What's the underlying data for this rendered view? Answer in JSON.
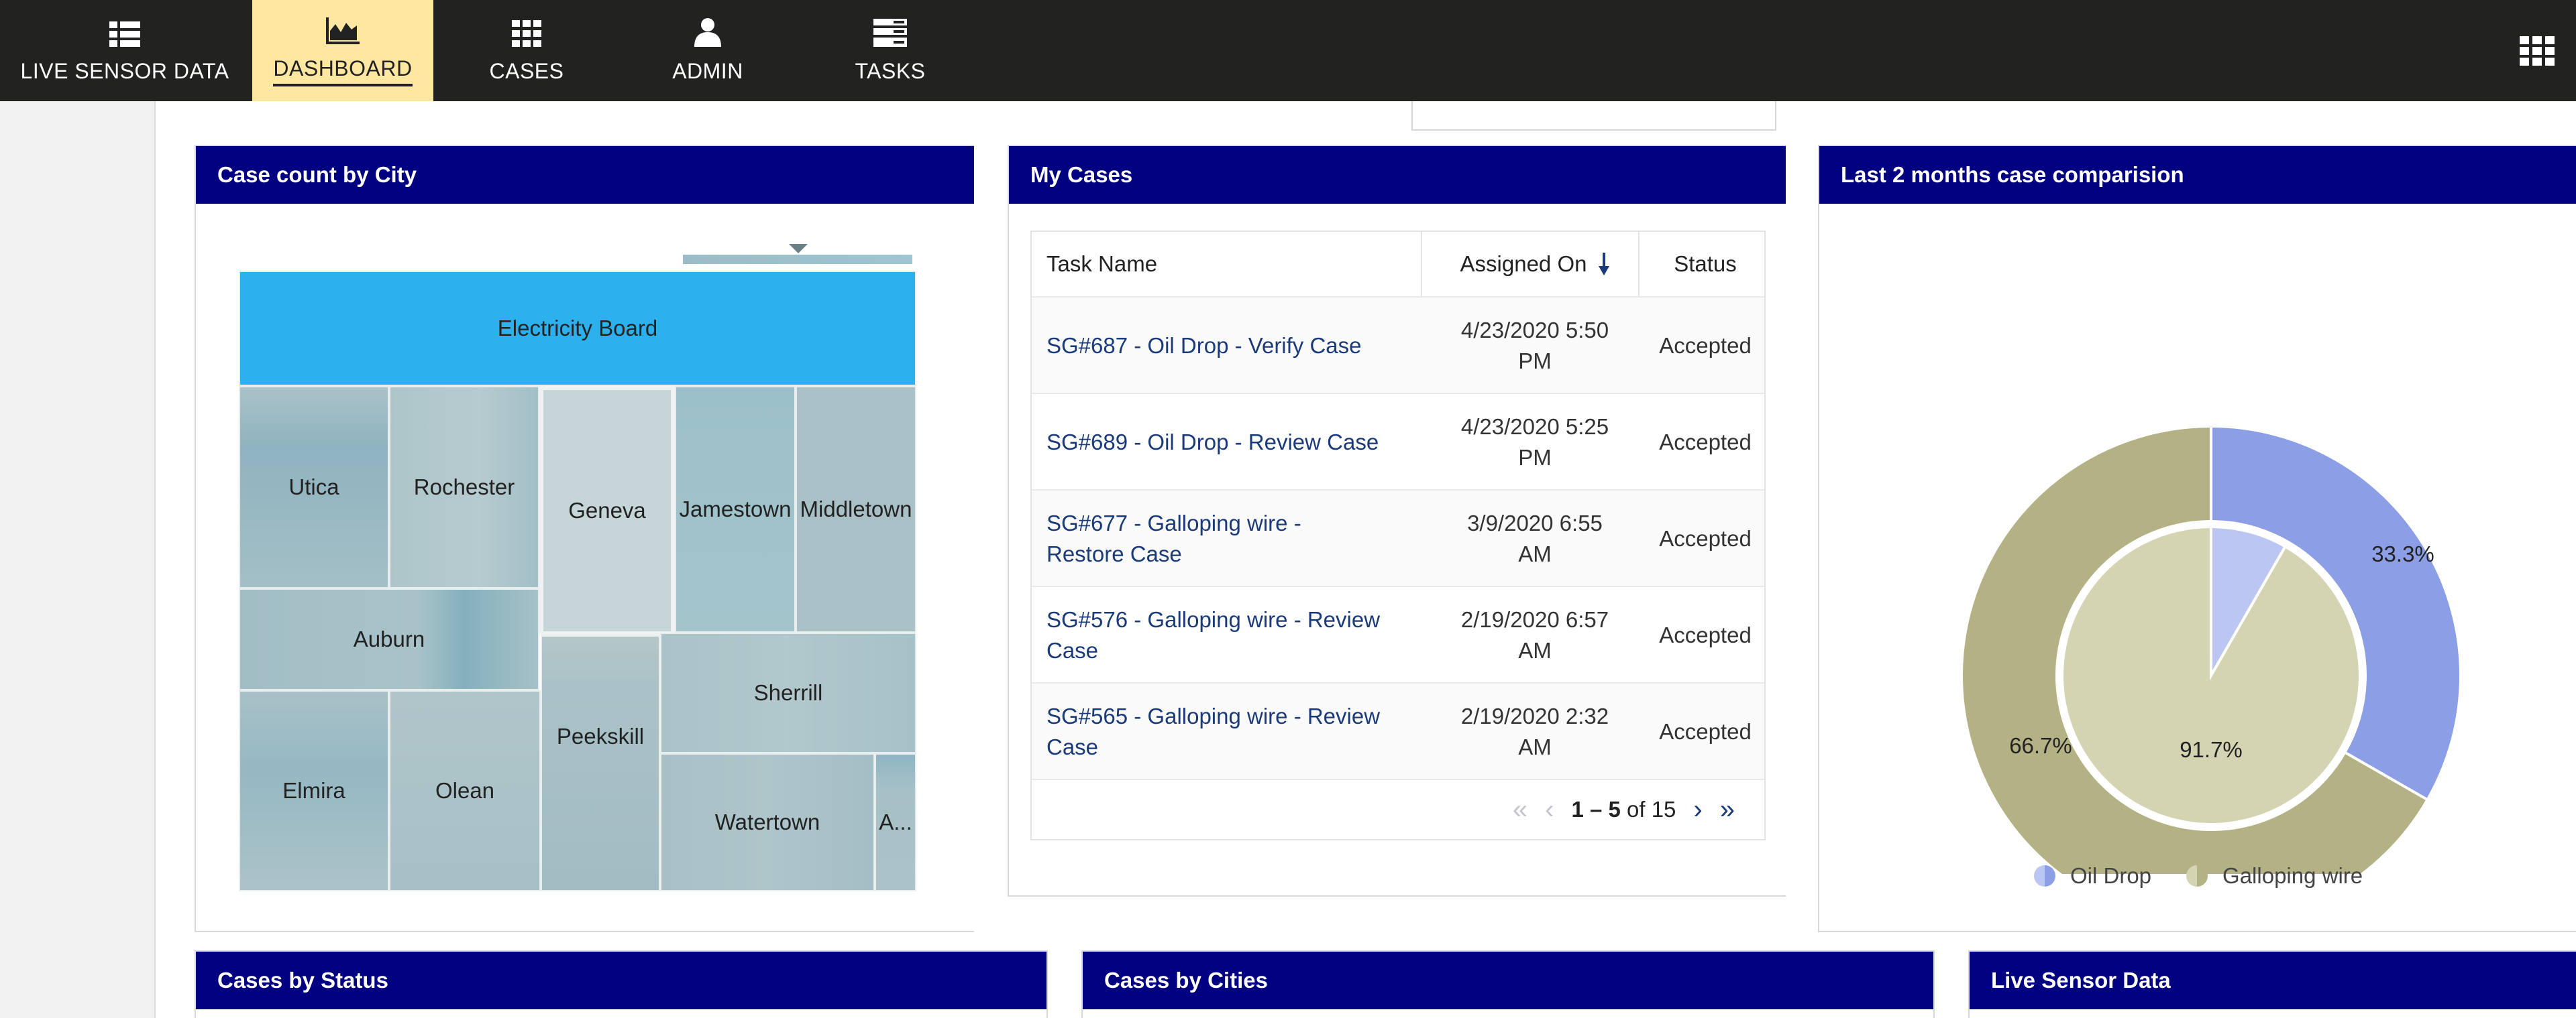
{
  "nav": {
    "items": [
      {
        "label": "LIVE SENSOR DATA",
        "icon": "list-grid-icon"
      },
      {
        "label": "DASHBOARD",
        "icon": "area-chart-icon",
        "active": true
      },
      {
        "label": "CASES",
        "icon": "grid-icon"
      },
      {
        "label": "ADMIN",
        "icon": "user-icon"
      },
      {
        "label": "TASKS",
        "icon": "tasks-icon"
      }
    ],
    "apps_icon": "apps-grid-icon"
  },
  "panels": {
    "city": {
      "title": "Case count by City"
    },
    "my_cases": {
      "title": "My Cases"
    },
    "comparison": {
      "title": "Last 2 months case comparision"
    },
    "status": {
      "title": "Cases by Status"
    },
    "cities": {
      "title": "Cases by Cities"
    },
    "live": {
      "title": "Live Sensor Data"
    }
  },
  "treemap": {
    "root": "Electricity Board",
    "cities": [
      "Utica",
      "Rochester",
      "Geneva",
      "Jamestown",
      "Middletown",
      "Auburn",
      "Sherrill",
      "Elmira",
      "Olean",
      "Peekskill",
      "Watertown",
      "A..."
    ]
  },
  "cases_table": {
    "headers": {
      "task": "Task Name",
      "assigned": "Assigned On",
      "status": "Status"
    },
    "rows": [
      {
        "task": "SG#687 - Oil Drop - Verify Case",
        "assigned_l1": "4/23/2020 5:50",
        "assigned_l2": "PM",
        "status": "Accepted"
      },
      {
        "task": "SG#689 - Oil Drop - Review Case",
        "assigned_l1": "4/23/2020 5:25",
        "assigned_l2": "PM",
        "status": "Accepted"
      },
      {
        "task": "SG#677 - Galloping wire - Restore Case",
        "assigned_l1": "3/9/2020 6:55",
        "assigned_l2": "AM",
        "status": "Accepted"
      },
      {
        "task": "SG#576 - Galloping wire - Review Case",
        "assigned_l1": "2/19/2020 6:57",
        "assigned_l2": "AM",
        "status": "Accepted"
      },
      {
        "task": "SG#565 - Galloping wire - Review Case",
        "assigned_l1": "2/19/2020 2:32",
        "assigned_l2": "AM",
        "status": "Accepted"
      }
    ],
    "pager": {
      "range": "1 – 5",
      "of": "of 15"
    }
  },
  "chart_data": {
    "type": "pie",
    "title": "Last 2 months case comparision",
    "legend": "bottom",
    "outer": [
      {
        "name": "Oil Drop",
        "value": 33.3,
        "label": "33.3%",
        "color": "#8c9fe6"
      },
      {
        "name": "Galloping wire",
        "value": 66.7,
        "label": "66.7%",
        "color": "#b4b185"
      }
    ],
    "inner": [
      {
        "name": "Oil Drop",
        "value": 8.3,
        "label": "",
        "color": "#bcc6f2"
      },
      {
        "name": "Galloping wire",
        "value": 91.7,
        "label": "91.7%",
        "color": "#d4d3b2"
      }
    ]
  }
}
